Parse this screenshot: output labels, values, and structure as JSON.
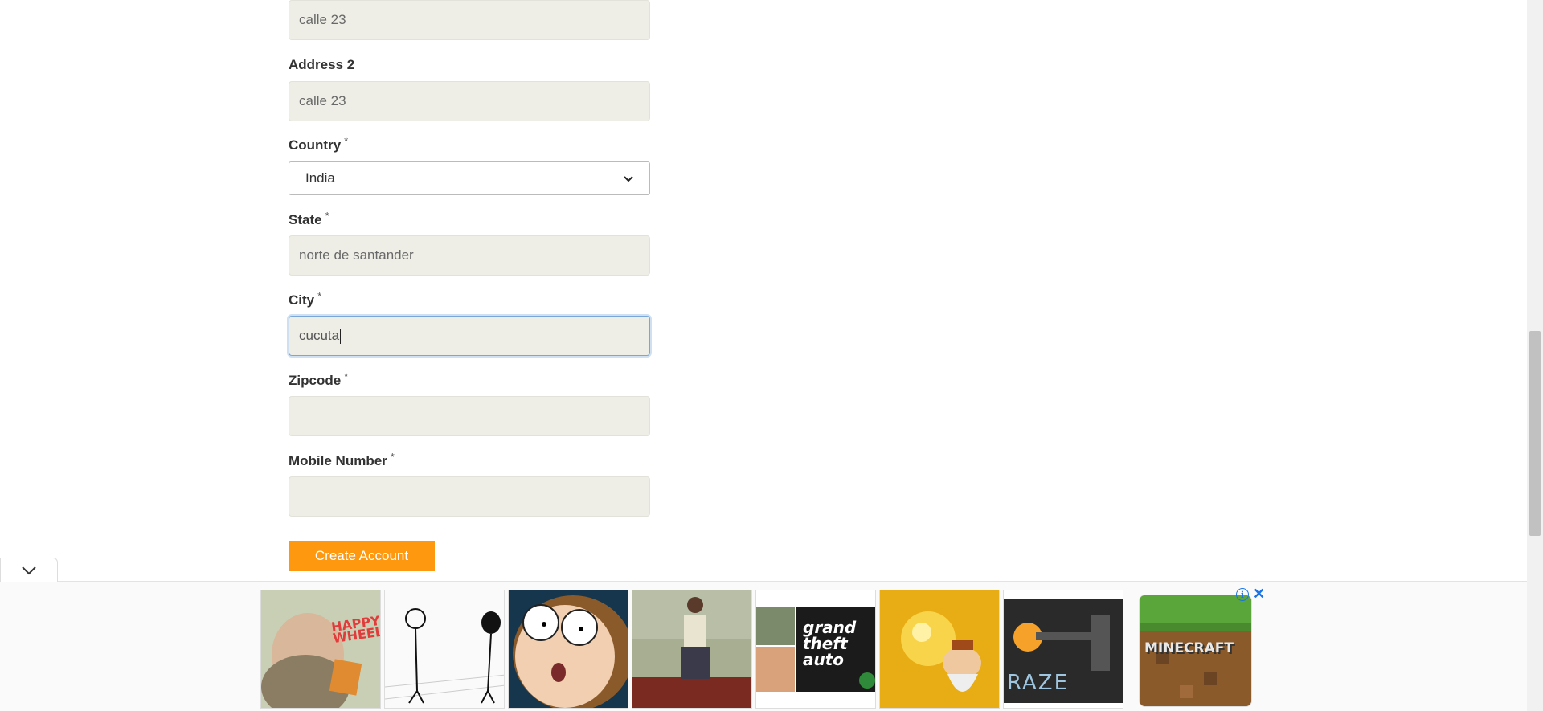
{
  "form": {
    "address1": {
      "value": "calle 23"
    },
    "address2": {
      "label": "Address 2",
      "value": "calle 23"
    },
    "country": {
      "label": "Country",
      "required": "*",
      "selected": "India"
    },
    "state": {
      "label": "State",
      "required": "*",
      "value": "norte de santander"
    },
    "city": {
      "label": "City",
      "required": "*",
      "value": "cucuta"
    },
    "zipcode": {
      "label": "Zipcode",
      "required": "*",
      "value": ""
    },
    "mobile": {
      "label": "Mobile Number",
      "required": "*",
      "value": ""
    },
    "create_button": "Create Account"
  },
  "ads": {
    "tiles": [
      {
        "name": "happy-wheels",
        "text": "HAPPY WHEELS"
      },
      {
        "name": "stick-figures",
        "text": ""
      },
      {
        "name": "morty-face",
        "text": ""
      },
      {
        "name": "gta-san-andreas",
        "text": ""
      },
      {
        "name": "gta-v",
        "text": "grand theft auto"
      },
      {
        "name": "gold-miner",
        "text": ""
      },
      {
        "name": "raze",
        "text": "RAZE"
      },
      {
        "name": "minecraft",
        "text": "MINECRAFT"
      }
    ],
    "info_icon": "i",
    "close_icon": "✕"
  },
  "colors": {
    "button": "#fe980f",
    "input_bg": "#eeeee6",
    "focus_border": "#7aa7d8"
  }
}
